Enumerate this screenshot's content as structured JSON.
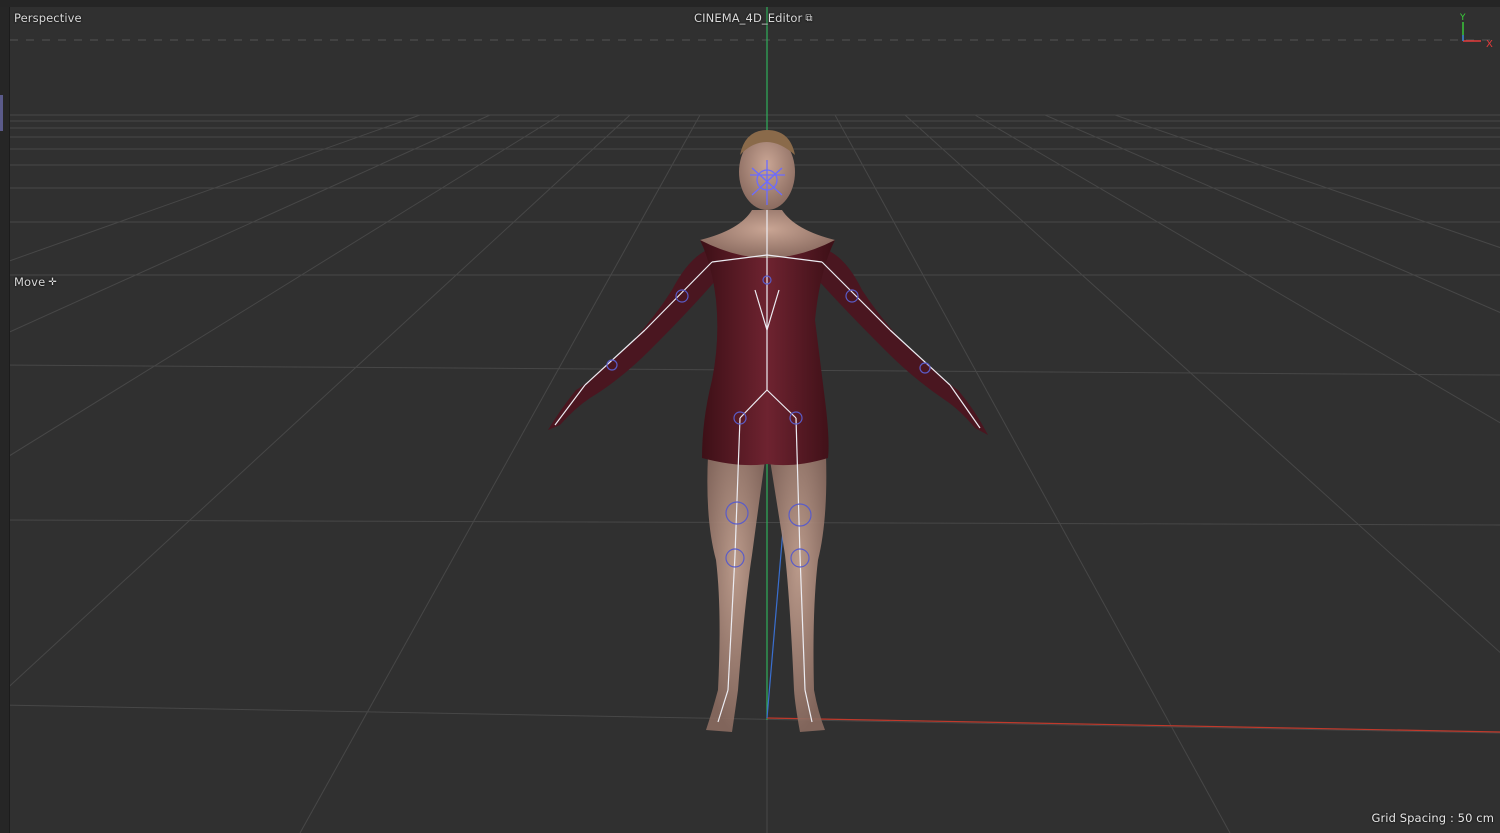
{
  "viewport": {
    "view_name": "Perspective",
    "camera_name": "CINEMA_4D_Editor",
    "camera_icon": "camera-link-icon",
    "tool_label": "Move",
    "tool_icon": "move-cross-icon",
    "grid_spacing": "Grid Spacing : 50 cm"
  },
  "axis_gizmo": {
    "y_label": "Y",
    "x_label": "X",
    "y_color": "#3ad13a",
    "x_color": "#e53a3a",
    "z_color": "#3a7ae5"
  },
  "colors": {
    "background": "#303030",
    "grid_line": "#4a4a4a",
    "y_axis_line": "#2fae5a",
    "x_axis_line": "#c0392b",
    "z_axis_line": "#3a6fd0",
    "dress": "#5a1a24",
    "skin": "#b89484",
    "bones": "#e8e8f0",
    "joint_rings": "#5a5cc8"
  },
  "scene": {
    "object": "rigged-female-character",
    "pose": "A-pose"
  }
}
